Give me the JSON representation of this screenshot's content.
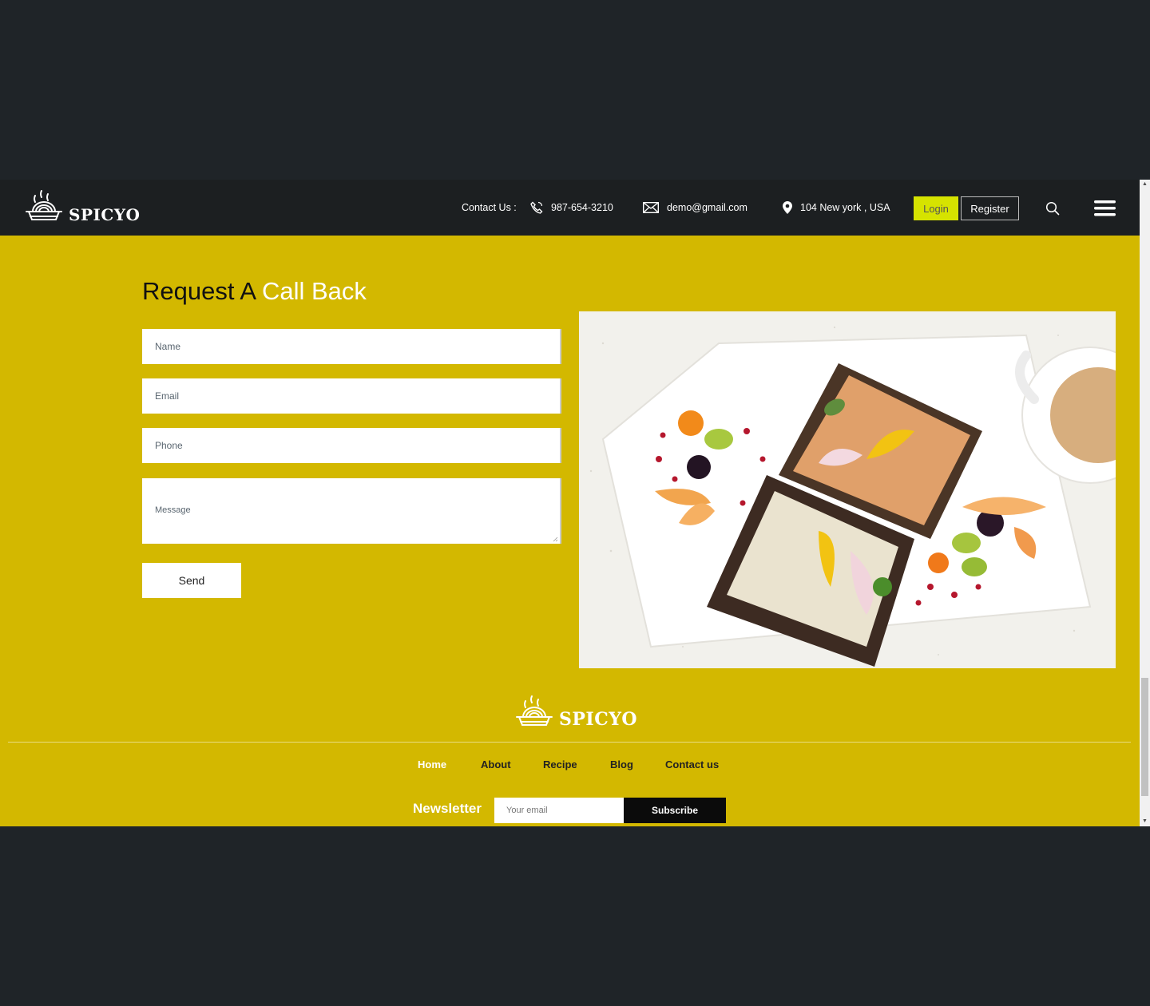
{
  "header": {
    "brand": "SPICYO",
    "contact_label": "Contact Us :",
    "phone": "987-654-3210",
    "email": "demo@gmail.com",
    "address": "104 New york , USA",
    "login_label": "Login",
    "register_label": "Register"
  },
  "form": {
    "title_prefix": "Request A",
    "title_highlight": "Call Back",
    "name_placeholder": "Name",
    "email_placeholder": "Email",
    "phone_placeholder": "Phone",
    "message_placeholder": "Message",
    "send_label": "Send"
  },
  "footer": {
    "brand": "SPICYO",
    "nav": [
      "Home",
      "About",
      "Recipe",
      "Blog",
      "Contact us"
    ],
    "newsletter_label": "Newsletter",
    "newsletter_placeholder": "Your email",
    "subscribe_label": "Subscribe"
  },
  "colors": {
    "accent": "#d3b800",
    "header_bg": "#1c1f21",
    "login_bg": "#d6e300",
    "page_bg": "#1f2428"
  }
}
